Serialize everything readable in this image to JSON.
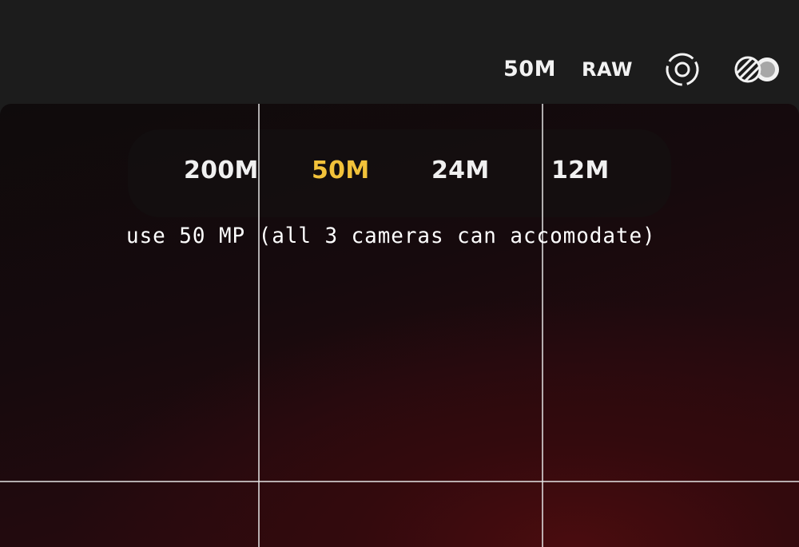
{
  "top_bar": {
    "resolution_label": "50M",
    "raw_label": "RAW",
    "live_icon": "live-photo-icon",
    "filter_icon": "filter-icon"
  },
  "resolution_selector": {
    "options": [
      {
        "label": "200M",
        "selected": false
      },
      {
        "label": "50M",
        "selected": true
      },
      {
        "label": "24M",
        "selected": false
      },
      {
        "label": "12M",
        "selected": false
      }
    ]
  },
  "annotation": {
    "text": "use 50 MP (all 3 cameras can accomodate)"
  },
  "colors": {
    "selected": "#f2c23a",
    "text": "#f0f0f0",
    "toolbar_bg": "#1c1c1c"
  }
}
